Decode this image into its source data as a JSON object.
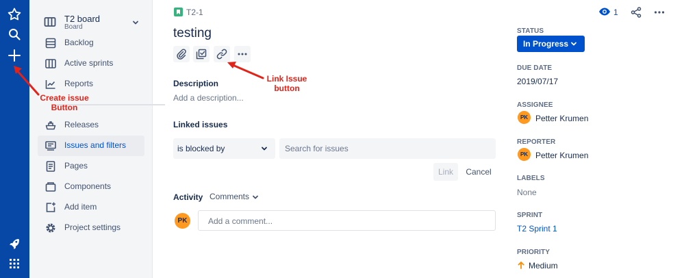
{
  "global_nav": {
    "icons": [
      "star-icon",
      "search-icon",
      "plus-icon",
      "rocket-icon",
      "app-switcher-icon"
    ]
  },
  "sidebar": {
    "board_title": "T2 board",
    "board_subtitle": "Board",
    "items": [
      {
        "label": "Backlog",
        "icon": "backlog-icon"
      },
      {
        "label": "Active sprints",
        "icon": "active-sprints-icon"
      },
      {
        "label": "Reports",
        "icon": "reports-icon"
      },
      {
        "label": "Releases",
        "icon": "releases-icon"
      },
      {
        "label": "Issues and filters",
        "icon": "issues-filters-icon",
        "active": true
      },
      {
        "label": "Pages",
        "icon": "pages-icon"
      },
      {
        "label": "Components",
        "icon": "components-icon"
      },
      {
        "label": "Add item",
        "icon": "add-item-icon"
      },
      {
        "label": "Project settings",
        "icon": "settings-icon"
      }
    ]
  },
  "issue": {
    "key": "T2-1",
    "title": "testing",
    "watch_count": "1",
    "description_heading": "Description",
    "description_placeholder": "Add a description...",
    "linked_heading": "Linked issues",
    "link_type": "is blocked by",
    "search_placeholder": "Search for issues",
    "link_button": "Link",
    "cancel_button": "Cancel",
    "activity_heading": "Activity",
    "activity_filter": "Comments",
    "commenter_initials": "PK",
    "comment_placeholder": "Add a comment..."
  },
  "details": {
    "status_label": "STATUS",
    "status_value": "In Progress",
    "due_label": "DUE DATE",
    "due_value": "2019/07/17",
    "assignee_label": "ASSIGNEE",
    "assignee_name": "Petter Krumen",
    "assignee_initials": "PK",
    "reporter_label": "REPORTER",
    "reporter_name": "Petter Krumen",
    "reporter_initials": "PK",
    "labels_label": "LABELS",
    "labels_value": "None",
    "sprint_label": "SPRINT",
    "sprint_value": "T2 Sprint 1",
    "priority_label": "PRIORITY",
    "priority_value": "Medium"
  },
  "annotations": {
    "create_issue_line1": "Create issue",
    "create_issue_line2": "Button",
    "link_issue_line1": "Link Issue",
    "link_issue_line2": "button"
  },
  "colors": {
    "global_nav": "#0747a6",
    "status_button": "#0052cc",
    "avatar": "#ff991f",
    "annotation_red": "#e2231a",
    "priority_medium": "#ff8b00"
  }
}
